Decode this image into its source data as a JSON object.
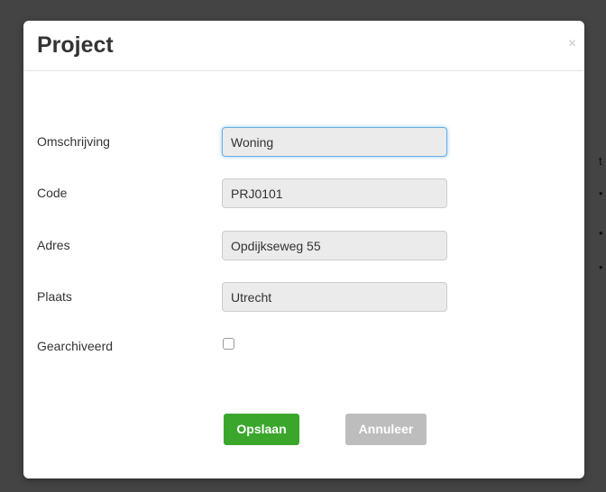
{
  "modal": {
    "title": "Project",
    "close_symbol": "×",
    "close_icon": "close-icon"
  },
  "form": {
    "fields": [
      {
        "label": "Omschrijving",
        "value": "Woning"
      },
      {
        "label": "Code",
        "value": "PRJ0101"
      },
      {
        "label": "Adres",
        "value": "Opdijkseweg 55"
      },
      {
        "label": "Plaats",
        "value": "Utrecht"
      }
    ],
    "archived": {
      "label": "Gearchiveerd",
      "checked": false
    }
  },
  "buttons": {
    "save_label": "Opslaan",
    "cancel_label": "Annuleer"
  },
  "colors": {
    "save": "#3aa72c",
    "cancel": "#bdbdbd",
    "focus": "#66afe9"
  }
}
